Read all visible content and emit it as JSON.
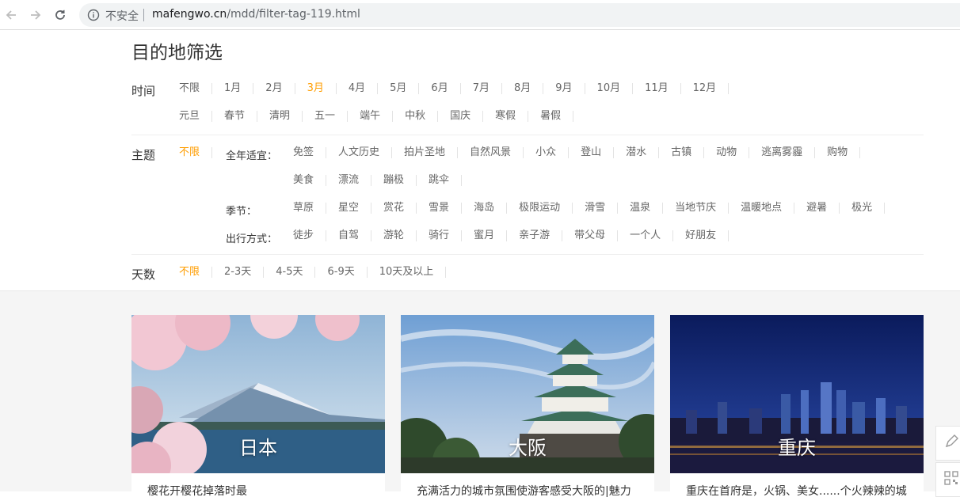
{
  "browser": {
    "insecure_label": "不安全",
    "url_domain": "mafengwo.cn",
    "url_path": "/mdd/filter-tag-119.html"
  },
  "page_title": "目的地筛选",
  "time": {
    "label": "时间",
    "months": [
      "不限",
      "1月",
      "2月",
      "3月",
      "4月",
      "5月",
      "6月",
      "7月",
      "8月",
      "9月",
      "10月",
      "11月",
      "12月"
    ],
    "months_active": "3月",
    "holidays": [
      "元旦",
      "春节",
      "清明",
      "五一",
      "端午",
      "中秋",
      "国庆",
      "寒假",
      "暑假"
    ]
  },
  "theme": {
    "label": "主题",
    "unlimited": "不限",
    "all_year_label": "全年适宜：",
    "all_year_1": [
      "免签",
      "人文历史",
      "拍片圣地",
      "自然风景",
      "小众",
      "登山",
      "潜水",
      "古镇",
      "动物",
      "逃离雾霾",
      "购物"
    ],
    "all_year_2": [
      "美食",
      "漂流",
      "蹦极",
      "跳伞"
    ],
    "season_label": "季节：",
    "season": [
      "草原",
      "星空",
      "赏花",
      "雪景",
      "海岛",
      "极限运动",
      "滑雪",
      "温泉",
      "当地节庆",
      "温暖地点",
      "避暑",
      "极光"
    ],
    "travel_label": "出行方式：",
    "travel": [
      "徒步",
      "自驾",
      "游轮",
      "骑行",
      "蜜月",
      "亲子游",
      "带父母",
      "一个人",
      "好朋友"
    ]
  },
  "days": {
    "label": "天数",
    "options": [
      "不限",
      "2-3天",
      "4-5天",
      "6-9天",
      "10天及以上"
    ],
    "active": "不限"
  },
  "cards": [
    {
      "name": "日本",
      "desc": "樱花开樱花掉落时最"
    },
    {
      "name": "大阪",
      "desc": "充满活力的城市氛围使游客感受大阪的|魅力"
    },
    {
      "name": "重庆",
      "desc": "重庆在首府是，火锅、美女......个火辣辣的城"
    }
  ],
  "colors": {
    "accent": "#ff9d00",
    "text": "#333333",
    "muted": "#666666"
  }
}
